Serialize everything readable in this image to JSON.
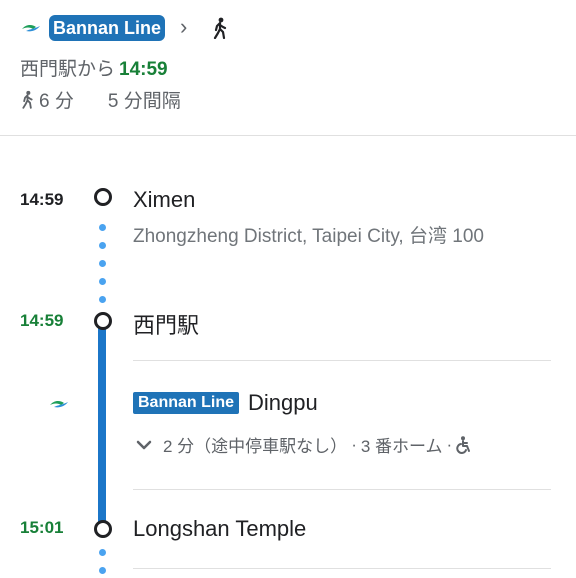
{
  "header": {
    "line_name": "Bannan Line",
    "from_station": "西門駅から",
    "depart_time": "14:59",
    "walk_duration": "6 分",
    "frequency": "5 分間隔"
  },
  "timeline": {
    "origin": {
      "time": "14:59",
      "name": "Ximen",
      "address": "Zhongzheng District, Taipei City, 台湾 100"
    },
    "board": {
      "time": "14:59",
      "name": "西門駅"
    },
    "ride": {
      "line_name": "Bannan Line",
      "direction": "Dingpu",
      "duration": "2 分（途中停車駅なし）",
      "platform": "3 番ホーム",
      "separator": "·"
    },
    "alight": {
      "time": "15:01",
      "name": "Longshan Temple"
    }
  },
  "colors": {
    "line_blue": "#1b76c8",
    "badge_blue": "#1f73b7",
    "green_time": "#188038",
    "walk_dots": "#4aa3f0",
    "mrt_logo_green": "#1e9e5a",
    "mrt_logo_blue": "#2d8fd8"
  },
  "icons": [
    "mrt-logo-icon",
    "chevron-right-icon",
    "walk-icon",
    "chevron-down-icon",
    "wheelchair-icon"
  ]
}
